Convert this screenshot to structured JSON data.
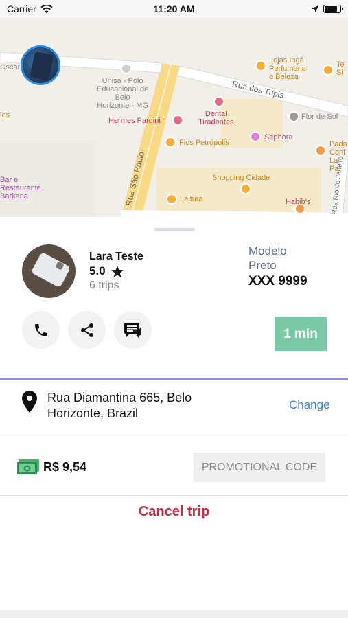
{
  "status_bar": {
    "carrier": "Carrier",
    "time": "11:20 AM",
    "battery_level": 0.85
  },
  "map": {
    "labels": {
      "unisa": "Unisa - Polo\nEducacional de\nBelo\nHorizonte - MG",
      "hermes": "Hermes Pardini",
      "dental": "Dental\nTiradentes",
      "flor": "Flor de Sol",
      "fios": "Fios Petrópolis",
      "sephora": "Sephora",
      "shopping": "Shopping Cidade",
      "leitura": "Leitura",
      "habib": "Habib's",
      "bar": "Bar e\nRestaurante\nBarkana",
      "rua_tupis": "Rua dos Tupis",
      "rua_sao_paulo": "Rua São Paulo",
      "rua_janeiro": "Rua Rio de Janeiro",
      "lojas": "Lojas Ingá\nPerfumaria\ne Beleza",
      "left_partial": "Oscar",
      "los": "los",
      "padaria": "Pada\nConf\nLa Pa",
      "te_partial": "Te\nSi"
    }
  },
  "driver": {
    "name": "Lara Teste",
    "rating": "5.0",
    "trips": "6 trips"
  },
  "car": {
    "model": "Modelo",
    "color": "Preto",
    "plate": "XXX 9999"
  },
  "actions": {
    "eta": "1 min"
  },
  "destination": {
    "address": "Rua Diamantina 665, Belo Horizonte, Brazil",
    "change_label": "Change"
  },
  "payment": {
    "price": "R$ 9,54",
    "promo_label": "PROMOTIONAL CODE"
  },
  "cancel_label": "Cancel trip",
  "colors": {
    "eta_bg": "#79c9a6",
    "cancel": "#d6263d",
    "link": "#3f7fd6",
    "divider_accent": "#8f8fd0"
  }
}
